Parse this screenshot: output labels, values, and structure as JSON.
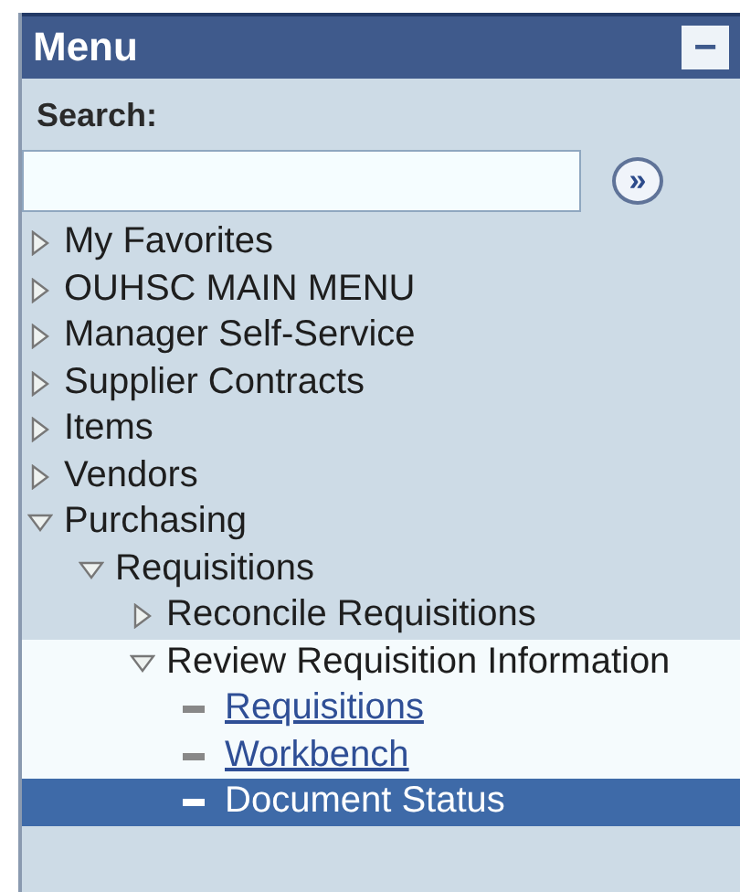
{
  "menu": {
    "title": "Menu",
    "collapse_icon": "−",
    "search": {
      "label": "Search:",
      "go_icon": "»"
    },
    "items": [
      {
        "label": "My Favorites",
        "kind": "folder",
        "expanded": false
      },
      {
        "label": "OUHSC MAIN MENU",
        "kind": "folder",
        "expanded": false
      },
      {
        "label": "Manager Self-Service",
        "kind": "folder",
        "expanded": false
      },
      {
        "label": "Supplier Contracts",
        "kind": "folder",
        "expanded": false
      },
      {
        "label": "Items",
        "kind": "folder",
        "expanded": false
      },
      {
        "label": "Vendors",
        "kind": "folder",
        "expanded": false
      },
      {
        "label": "Purchasing",
        "kind": "folder",
        "expanded": true,
        "children": [
          {
            "label": "Requisitions",
            "kind": "folder",
            "expanded": true,
            "children": [
              {
                "label": "Reconcile Requisitions",
                "kind": "folder",
                "expanded": false
              },
              {
                "label": "Review Requisition Information",
                "kind": "folder",
                "expanded": true,
                "highlighted": true,
                "children": [
                  {
                    "label": "Requisitions",
                    "kind": "link",
                    "selected": false
                  },
                  {
                    "label": "Workbench",
                    "kind": "link",
                    "selected": false
                  },
                  {
                    "label": "Document Status",
                    "kind": "link",
                    "selected": true
                  }
                ]
              }
            ]
          }
        ]
      }
    ]
  }
}
